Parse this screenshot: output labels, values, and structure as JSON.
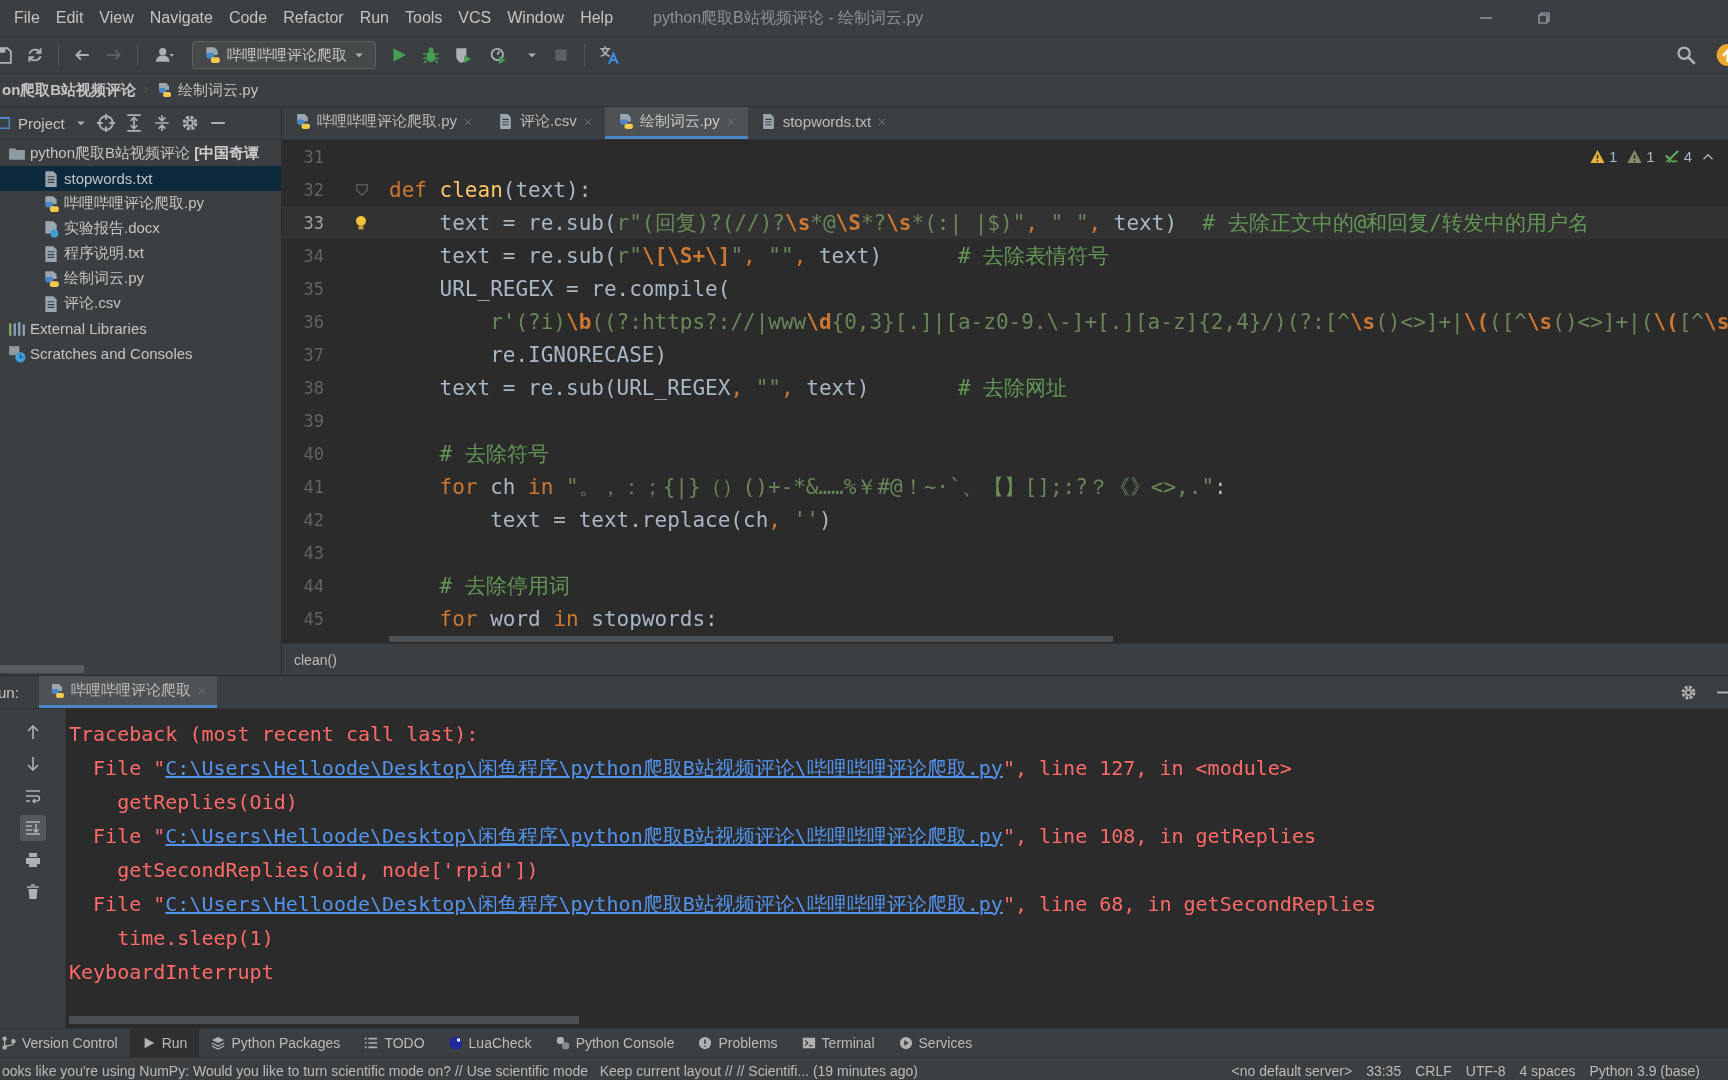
{
  "window": {
    "title": "python爬取B站视频评论 - 绘制词云.py"
  },
  "menu": [
    "File",
    "Edit",
    "View",
    "Navigate",
    "Code",
    "Refactor",
    "Run",
    "Tools",
    "VCS",
    "Window",
    "Help"
  ],
  "toolbar": {
    "run_configuration": "哔哩哔哩评论爬取"
  },
  "breadcrumb": [
    {
      "label": "on爬取B站视频评论"
    },
    {
      "label": "绘制词云.py",
      "kind": "python"
    }
  ],
  "project_panel": {
    "title": "Project",
    "tree": [
      {
        "label": "python爬取B站视频评论 **[中国奇谭**",
        "kind": "folder",
        "selected": false,
        "children": [
          {
            "label": "stopwords.txt",
            "kind": "text",
            "selected": true
          },
          {
            "label": "哔哩哔哩评论爬取.py",
            "kind": "python",
            "selected": false
          },
          {
            "label": "实验报告.docx",
            "kind": "unknown",
            "selected": false
          },
          {
            "label": "程序说明.txt",
            "kind": "text",
            "selected": false
          },
          {
            "label": "绘制词云.py",
            "kind": "python",
            "selected": false
          },
          {
            "label": "评论.csv",
            "kind": "text",
            "selected": false
          }
        ]
      },
      {
        "label": "External Libraries",
        "kind": "library",
        "selected": false
      },
      {
        "label": "Scratches and Consoles",
        "kind": "scratch",
        "selected": false
      }
    ]
  },
  "editor": {
    "tabs": [
      {
        "label": "哔哩哔哩评论爬取.py",
        "kind": "python",
        "selected": false
      },
      {
        "label": "评论.csv",
        "kind": "text",
        "selected": false
      },
      {
        "label": "绘制词云.py",
        "kind": "python",
        "selected": true
      },
      {
        "label": "stopwords.txt",
        "kind": "text",
        "selected": false
      }
    ],
    "inspections": [
      {
        "kind": "warning",
        "count": "1"
      },
      {
        "kind": "weak",
        "count": "1"
      },
      {
        "kind": "typo",
        "count": "4"
      }
    ],
    "lines": [
      {
        "number": "31",
        "current": false
      },
      {
        "number": "32",
        "current": false,
        "kind": "fold",
        "segments": [
          {
            "kind": "kw",
            "text": "def "
          },
          {
            "kind": "fn",
            "text": "clean"
          },
          {
            "kind": "p",
            "text": "(text):"
          }
        ]
      },
      {
        "number": "33",
        "current": true,
        "kind": "bulb",
        "segments": [
          {
            "kind": "p",
            "text": "    text = re.sub("
          },
          {
            "kind": "str",
            "text": "r\"(回复)?(//)?"
          },
          {
            "kind": "esc",
            "text": "\\s"
          },
          {
            "kind": "str",
            "text": "*@"
          },
          {
            "kind": "esc",
            "text": "\\S"
          },
          {
            "kind": "str",
            "text": "*?"
          },
          {
            "kind": "esc",
            "text": "\\s"
          },
          {
            "kind": "str",
            "text": "*(:| |$)\""
          },
          {
            "kind": "kw",
            "text": ", "
          },
          {
            "kind": "str",
            "text": "\" \""
          },
          {
            "kind": "kw",
            "text": ", "
          },
          {
            "kind": "p",
            "text": "text)  "
          },
          {
            "kind": "cmt",
            "text": "# 去除正文中的@和回复/转发中的用户名"
          }
        ]
      },
      {
        "number": "34",
        "current": false,
        "segments": [
          {
            "kind": "p",
            "text": "    text = re.sub("
          },
          {
            "kind": "str",
            "text": "r\""
          },
          {
            "kind": "esc",
            "text": "\\[\\S+\\]"
          },
          {
            "kind": "str",
            "text": "\""
          },
          {
            "kind": "kw",
            "text": ", "
          },
          {
            "kind": "str",
            "text": "\"\""
          },
          {
            "kind": "kw",
            "text": ", "
          },
          {
            "kind": "p",
            "text": "text)      "
          },
          {
            "kind": "cmt",
            "text": "# 去除表情符号"
          }
        ]
      },
      {
        "number": "35",
        "current": false,
        "segments": [
          {
            "kind": "p",
            "text": "    URL_REGEX = re.compile("
          }
        ]
      },
      {
        "number": "36",
        "current": false,
        "segments": [
          {
            "kind": "str",
            "text": "        r'(?i)"
          },
          {
            "kind": "esc",
            "text": "\\b"
          },
          {
            "kind": "str",
            "text": "((?:https?://|www"
          },
          {
            "kind": "esc",
            "text": "\\d"
          },
          {
            "kind": "str",
            "text": "{0,3}[.]|[a-z0-9.\\-]+[.][a-z]{2,4}/)(?:[^"
          },
          {
            "kind": "esc",
            "text": "\\s"
          },
          {
            "kind": "str",
            "text": "()<>]+|"
          },
          {
            "kind": "esc",
            "text": "\\("
          },
          {
            "kind": "str",
            "text": "([^"
          },
          {
            "kind": "esc",
            "text": "\\s"
          },
          {
            "kind": "str",
            "text": "()<>]+|("
          },
          {
            "kind": "esc",
            "text": "\\("
          },
          {
            "kind": "str",
            "text": "[^"
          },
          {
            "kind": "esc",
            "text": "\\s"
          }
        ]
      },
      {
        "number": "37",
        "current": false,
        "segments": [
          {
            "kind": "p",
            "text": "        re.IGNORECASE)"
          }
        ]
      },
      {
        "number": "38",
        "current": false,
        "segments": [
          {
            "kind": "p",
            "text": "    text = re.sub(URL_REGEX"
          },
          {
            "kind": "kw",
            "text": ", "
          },
          {
            "kind": "str",
            "text": "\"\""
          },
          {
            "kind": "kw",
            "text": ", "
          },
          {
            "kind": "p",
            "text": "text)       "
          },
          {
            "kind": "cmt",
            "text": "# 去除网址"
          }
        ]
      },
      {
        "number": "39",
        "current": false
      },
      {
        "number": "40",
        "current": false,
        "segments": [
          {
            "kind": "cmt",
            "text": "    # 去除符号"
          }
        ]
      },
      {
        "number": "41",
        "current": false,
        "segments": [
          {
            "kind": "kw",
            "text": "    for"
          },
          {
            "kind": "p",
            "text": " ch "
          },
          {
            "kind": "kw",
            "text": "in"
          },
          {
            "kind": "str",
            "text": " \"。，：；{|}（）()+-*&……%￥#@！~·`、【】[];:?？《》<>,.\""
          },
          {
            "kind": "p",
            "text": ":"
          }
        ]
      },
      {
        "number": "42",
        "current": false,
        "segments": [
          {
            "kind": "p",
            "text": "        text = text.replace(ch"
          },
          {
            "kind": "kw",
            "text": ", "
          },
          {
            "kind": "str",
            "text": "''"
          },
          {
            "kind": "p",
            "text": ")"
          }
        ]
      },
      {
        "number": "43",
        "current": false
      },
      {
        "number": "44",
        "current": false,
        "segments": [
          {
            "kind": "cmt",
            "text": "    # 去除停用词"
          }
        ]
      },
      {
        "number": "45",
        "current": false,
        "segments": [
          {
            "kind": "kw",
            "text": "    for"
          },
          {
            "kind": "p",
            "text": " word "
          },
          {
            "kind": "kw",
            "text": "in"
          },
          {
            "kind": "p",
            "text": " stopwords:"
          }
        ]
      }
    ],
    "footer": "clean()"
  },
  "run_panel": {
    "label": "un:",
    "tabs": [
      {
        "label": "哔哩哔哩评论爬取",
        "selected": true
      }
    ],
    "tools": [
      {
        "kind": "up",
        "selected": false
      },
      {
        "kind": "down",
        "selected": false
      },
      {
        "kind": "wrap",
        "selected": false
      },
      {
        "kind": "scroll-end",
        "selected": true
      },
      {
        "kind": "print",
        "selected": false
      },
      {
        "kind": "trash",
        "selected": false
      }
    ],
    "console": [
      {
        "segments": [
          {
            "kind": "err",
            "text": "Traceback (most recent call last):"
          }
        ]
      },
      {
        "segments": [
          {
            "kind": "err",
            "text": "  File \""
          },
          {
            "kind": "link",
            "text": "C:\\Users\\Helloode\\Desktop\\闲鱼程序\\python爬取B站视频评论\\哔哩哔哩评论爬取.py"
          },
          {
            "kind": "err",
            "text": "\", line 127, in <module>"
          }
        ]
      },
      {
        "segments": [
          {
            "kind": "err",
            "text": "    getReplies(Oid)"
          }
        ]
      },
      {
        "segments": [
          {
            "kind": "err",
            "text": "  File \""
          },
          {
            "kind": "link",
            "text": "C:\\Users\\Helloode\\Desktop\\闲鱼程序\\python爬取B站视频评论\\哔哩哔哩评论爬取.py"
          },
          {
            "kind": "err",
            "text": "\", line 108, in getReplies"
          }
        ]
      },
      {
        "segments": [
          {
            "kind": "err",
            "text": "    getSecondReplies(oid, node['rpid'])"
          }
        ]
      },
      {
        "segments": [
          {
            "kind": "err",
            "text": "  File \""
          },
          {
            "kind": "link",
            "text": "C:\\Users\\Helloode\\Desktop\\闲鱼程序\\python爬取B站视频评论\\哔哩哔哩评论爬取.py"
          },
          {
            "kind": "err",
            "text": "\", line 68, in getSecondReplies"
          }
        ]
      },
      {
        "segments": [
          {
            "kind": "err",
            "text": "    time.sleep(1)"
          }
        ]
      },
      {
        "segments": [
          {
            "kind": "err",
            "text": "KeyboardInterrupt"
          }
        ]
      }
    ]
  },
  "tool_windows": [
    {
      "label": "Version Control",
      "kind": "vcs",
      "selected": false
    },
    {
      "label": "Run",
      "kind": "run",
      "selected": true
    },
    {
      "label": "Python Packages",
      "kind": "packages",
      "selected": false
    },
    {
      "label": "TODO",
      "kind": "todo",
      "selected": false
    },
    {
      "label": "LuaCheck",
      "kind": "lua",
      "selected": false
    },
    {
      "label": "Python Console",
      "kind": "python",
      "selected": false
    },
    {
      "label": "Problems",
      "kind": "problems",
      "selected": false
    },
    {
      "label": "Terminal",
      "kind": "terminal",
      "selected": false
    },
    {
      "label": "Services",
      "kind": "services",
      "selected": false
    }
  ],
  "status_bar": {
    "message": "ooks like you're using NumPy: Would you like to turn scientific mode on? // Use scientific mode   Keep current layout // // Scientifi... (19 minutes ago)",
    "items": [
      "<no default server>",
      "33:35",
      "CRLF",
      "UTF-8",
      "4 spaces",
      "Python 3.9 (base)"
    ]
  }
}
